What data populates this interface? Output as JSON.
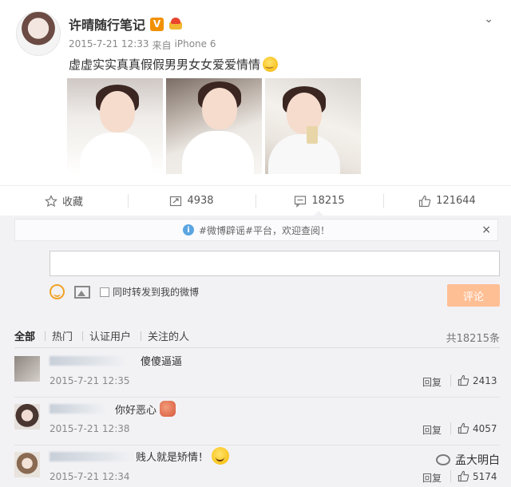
{
  "post": {
    "author": "许晴随行笔记",
    "verified_badge": "V",
    "timestamp": "2015-7-21 12:33",
    "source_prefix": "来自",
    "device": "iPhone 6",
    "text": "虚虚实实真真假假男男女女爱爱情情",
    "emoji_icon": "smile-emoji-icon",
    "images": [
      "photo-1",
      "photo-2",
      "photo-3"
    ]
  },
  "actions": {
    "favorite": "收藏",
    "repost_count": "4938",
    "comment_count": "18215",
    "like_count": "121644"
  },
  "comments_panel": {
    "notice": "#微博辟谣#平台，欢迎查阅！",
    "notice_close": "×",
    "input_placeholder": "",
    "forward_label": "同时转发到我的微博",
    "submit_label": "评论",
    "filters": [
      "全部",
      "热门",
      "认证用户",
      "关注的人"
    ],
    "total": "共18215条",
    "reply_label": "回复",
    "items": [
      {
        "text": "傻傻逼逼",
        "time": "2015-7-21 12:35",
        "likes": "2413"
      },
      {
        "text": "你好恶心",
        "time": "2015-7-21 12:38",
        "likes": "4057"
      },
      {
        "text": "贱人就是矫情！",
        "time": "2015-7-21 12:34",
        "likes": "5174"
      }
    ]
  },
  "watermark": "孟大明白",
  "colors": {
    "accent_orange": "#ffbf95",
    "verified": "#f29100",
    "info": "#5ba5e0",
    "panel_bg": "#f2f2f5"
  }
}
